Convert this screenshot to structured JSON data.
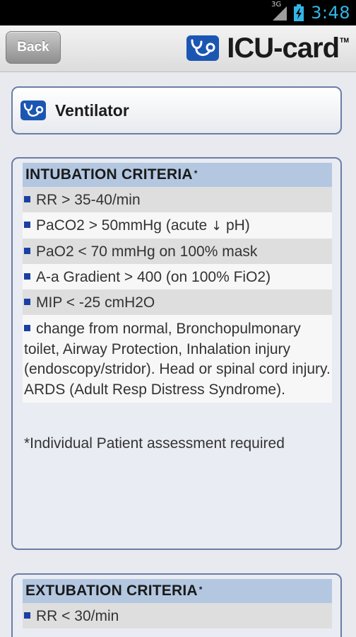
{
  "status_bar": {
    "network_label": "3G",
    "time": "3:48",
    "accent_color": "#33b5e5"
  },
  "header": {
    "back_label": "Back",
    "brand_name": "ICU-card",
    "brand_tm": "TM"
  },
  "section": {
    "title": "Ventilator",
    "icon": "stethoscope-icon"
  },
  "intubation": {
    "title": "INTUBATION CRITERIA",
    "title_marker": "*",
    "items": [
      "RR > 35-40/min",
      "PaCO2 > 50mmHg (acute ",
      "PaO2 < 70 mmHg on 100% mask",
      "A-a Gradient > 400 (on 100% FiO2)",
      "MIP < -25 cmH2O",
      "change from normal, Bronchopulmonary toilet, Airway Protection, Inhalation injury (endoscopy/stridor). Head or spinal cord injury. ARDS (Adult Resp Distress Syndrome)."
    ],
    "item2_suffix": " pH)",
    "arrow_glyph": "↓",
    "note": "*Individual Patient assessment required"
  },
  "extubation": {
    "title": "EXTUBATION CRITERIA",
    "title_marker": "*",
    "items": [
      "RR < 30/min"
    ]
  }
}
